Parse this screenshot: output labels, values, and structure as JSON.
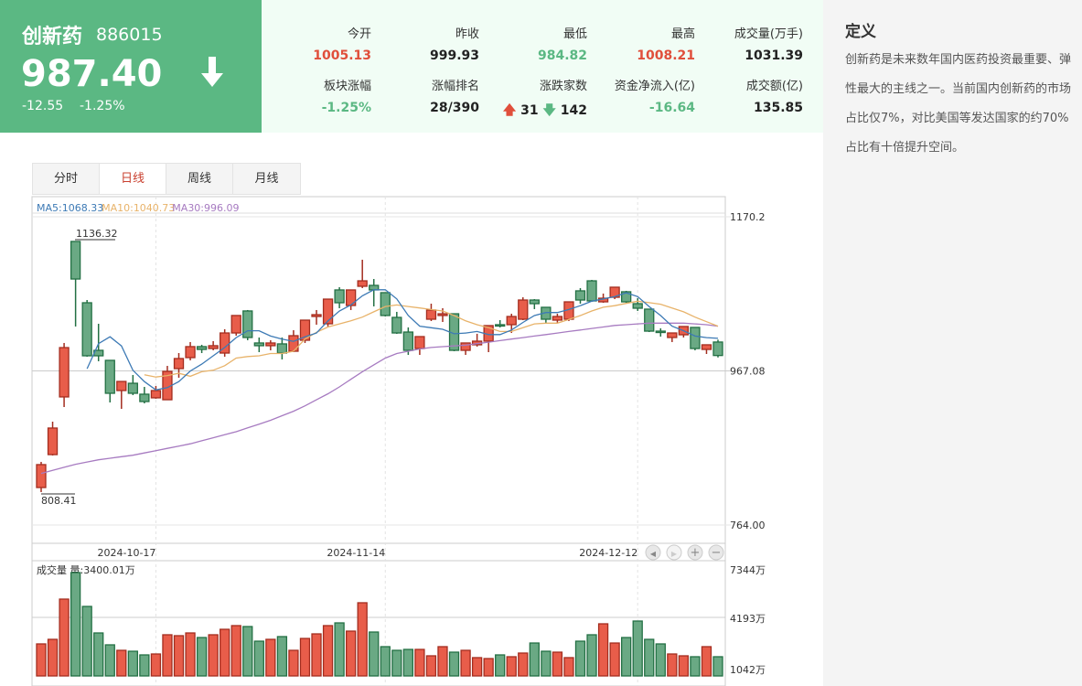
{
  "quote": {
    "name": "创新药",
    "code": "886015",
    "price": "987.40",
    "change": "-12.55",
    "change_pct": "-1.25%",
    "direction_icon": "arrow-down"
  },
  "stats": [
    {
      "label": "今开",
      "value": "1005.13",
      "tone": "red"
    },
    {
      "label": "昨收",
      "value": "999.93",
      "tone": "dark"
    },
    {
      "label": "最低",
      "value": "984.82",
      "tone": "green"
    },
    {
      "label": "最高",
      "value": "1008.21",
      "tone": "red"
    },
    {
      "label": "成交量(万手)",
      "value": "1031.39",
      "tone": "dark"
    },
    {
      "label": "板块涨幅",
      "value": "-1.25%",
      "tone": "green"
    },
    {
      "label": "涨幅排名",
      "value": "28/390",
      "tone": "dark"
    },
    {
      "label": "涨跌家数",
      "up": "31",
      "down": "142"
    },
    {
      "label": "资金净流入(亿)",
      "value": "-16.64",
      "tone": "green"
    },
    {
      "label": "成交额(亿)",
      "value": "135.85",
      "tone": "dark"
    }
  ],
  "definition": {
    "title": "定义",
    "text": "创新药是未来数年国内医药投资最重要、弹性最大的主线之一。当前国内创新药的市场占比仅7%，对比美国等发达国家的约70%占比有十倍提升空间。"
  },
  "tabs": [
    {
      "label": "分时",
      "active": false
    },
    {
      "label": "日线",
      "active": true
    },
    {
      "label": "周线",
      "active": false
    },
    {
      "label": "月线",
      "active": false
    }
  ],
  "colors": {
    "up": "#e85d4a",
    "down": "#6aa984",
    "ma5": "#3d7ab5",
    "ma10": "#e8b36a",
    "ma30": "#a77bc1"
  },
  "chart_data": {
    "type": "candlestick",
    "ma_legend": [
      {
        "label": "MA5:1068.33",
        "key": "ma5"
      },
      {
        "label": "MA10:1040.73",
        "key": "ma10"
      },
      {
        "label": "MA30:996.09",
        "key": "ma30"
      }
    ],
    "y_ticks": [
      "1170.2",
      "967.08",
      "764.00"
    ],
    "ylim": [
      764.0,
      1170.2
    ],
    "x_ticks": [
      {
        "label": "2024-10-17",
        "index": 10
      },
      {
        "label": "2024-11-14",
        "index": 30
      },
      {
        "label": "2024-12-12",
        "index": 52
      }
    ],
    "max_label": "1136.32",
    "min_label": "808.41",
    "candles": [
      [
        813.4,
        843.6,
        847.2,
        807.4
      ],
      [
        856.8,
        891.8,
        900.2,
        855.6
      ],
      [
        932.8,
        997.8,
        1003.9,
        919.5
      ],
      [
        1137.7,
        1088.2,
        1137.7,
        1025.6
      ],
      [
        1056.9,
        987.0,
        1060.5,
        985.8
      ],
      [
        994.2,
        987.0,
        1029.2,
        979.8
      ],
      [
        981.0,
        937.6,
        981.0,
        925.5
      ],
      [
        941.2,
        953.2,
        953.2,
        917.1
      ],
      [
        950.8,
        937.6,
        961.7,
        935.2
      ],
      [
        936.4,
        926.7,
        946.0,
        924.3
      ],
      [
        931.6,
        941.2,
        947.2,
        930.4
      ],
      [
        929.1,
        966.5,
        973.7,
        929.1
      ],
      [
        970.1,
        983.4,
        990.6,
        958.1
      ],
      [
        984.6,
        999.1,
        1005.1,
        981.0
      ],
      [
        999.1,
        995.4,
        1001.5,
        990.6
      ],
      [
        996.6,
        1000.3,
        1006.3,
        994.2
      ],
      [
        990.6,
        1017.1,
        1022.0,
        985.8
      ],
      [
        1017.1,
        1040.1,
        1040.1,
        1013.5
      ],
      [
        1046.1,
        1011.1,
        1047.3,
        1007.5
      ],
      [
        1003.9,
        1000.3,
        1011.1,
        991.8
      ],
      [
        1000.3,
        1003.9,
        1007.5,
        994.2
      ],
      [
        1002.7,
        990.6,
        1011.1,
        982.2
      ],
      [
        993.0,
        1013.5,
        1020.7,
        991.8
      ],
      [
        1007.5,
        1034.0,
        1034.0,
        1003.9
      ],
      [
        1038.8,
        1041.2,
        1047.3,
        1028.0
      ],
      [
        1029.2,
        1061.7,
        1061.7,
        1025.6
      ],
      [
        1073.8,
        1056.9,
        1077.4,
        1049.7
      ],
      [
        1053.3,
        1073.8,
        1073.8,
        1047.3
      ],
      [
        1078.6,
        1085.8,
        1113.6,
        1076.2
      ],
      [
        1079.8,
        1073.8,
        1088.2,
        1052.1
      ],
      [
        1070.2,
        1040.1,
        1070.2,
        1038.8
      ],
      [
        1037.6,
        1017.1,
        1044.9,
        1015.9
      ],
      [
        1018.3,
        994.2,
        1024.4,
        988.2
      ],
      [
        996.6,
        1012.3,
        1012.3,
        988.2
      ],
      [
        1035.2,
        1047.3,
        1055.7,
        1032.8
      ],
      [
        1040.1,
        1042.4,
        1049.7,
        1031.6
      ],
      [
        1042.4,
        994.2,
        1042.4,
        993.0
      ],
      [
        994.2,
        1003.9,
        1003.9,
        988.2
      ],
      [
        1001.5,
        1006.3,
        1016.0,
        999.1
      ],
      [
        1006.3,
        1026.8,
        1026.8,
        991.8
      ],
      [
        1028.0,
        1026.8,
        1034.0,
        1024.4
      ],
      [
        1028.0,
        1038.8,
        1042.4,
        1017.1
      ],
      [
        1035.2,
        1060.5,
        1064.1,
        1034.0
      ],
      [
        1060.5,
        1055.7,
        1061.7,
        1048.5
      ],
      [
        1050.9,
        1035.2,
        1050.9,
        1030.4
      ],
      [
        1034.0,
        1038.8,
        1042.4,
        1030.4
      ],
      [
        1035.2,
        1058.1,
        1058.1,
        1032.8
      ],
      [
        1072.6,
        1060.5,
        1076.2,
        1055.7
      ],
      [
        1085.8,
        1059.3,
        1087.0,
        1058.1
      ],
      [
        1058.1,
        1062.9,
        1069.0,
        1056.9
      ],
      [
        1064.1,
        1077.4,
        1077.4,
        1061.7
      ],
      [
        1071.4,
        1058.1,
        1072.6,
        1056.9
      ],
      [
        1055.7,
        1049.7,
        1062.9,
        1046.1
      ],
      [
        1048.5,
        1019.5,
        1048.5,
        1018.3
      ],
      [
        1019.5,
        1018.3,
        1023.2,
        1012.3
      ],
      [
        1011.1,
        1017.1,
        1017.1,
        1005.1
      ],
      [
        1014.7,
        1025.6,
        1025.6,
        1011.1
      ],
      [
        1024.4,
        996.6,
        1024.4,
        994.2
      ],
      [
        995.4,
        1001.5,
        1001.5,
        989.4
      ],
      [
        1005.13,
        987.4,
        1008.21,
        984.82
      ]
    ],
    "ma5": [
      null,
      null,
      null,
      null,
      970,
      1003,
      1012,
      1000,
      968,
      953,
      942,
      945,
      953,
      967,
      976,
      987,
      998,
      1011,
      1020,
      1020,
      1013,
      1009,
      1006,
      1012,
      1017,
      1033,
      1046,
      1054,
      1066,
      1074,
      1074,
      1062,
      1040,
      1026,
      1024,
      1022,
      1016,
      1017,
      1019,
      1015,
      1015,
      1021,
      1031,
      1040,
      1044,
      1044,
      1048,
      1053,
      1059,
      1062,
      1065,
      1070,
      1065,
      1052,
      1040,
      1026,
      1020,
      1013,
      1011,
      1010
    ],
    "ma10": [
      null,
      null,
      null,
      null,
      null,
      null,
      null,
      null,
      null,
      962,
      959,
      961,
      964,
      960,
      966,
      968,
      974,
      984,
      986,
      987,
      990,
      990,
      993,
      1009,
      1018,
      1025,
      1029,
      1033,
      1038,
      1045,
      1052,
      1054,
      1052,
      1050,
      1048,
      1046,
      1040,
      1033,
      1028,
      1024,
      1019,
      1019,
      1024,
      1029,
      1030,
      1030,
      1035,
      1040,
      1046,
      1051,
      1053,
      1056,
      1059,
      1057,
      1055,
      1050,
      1045,
      1038,
      1032,
      1026
    ],
    "ma30": [
      832,
      836,
      840,
      844,
      847,
      850,
      852,
      854,
      856,
      859,
      862,
      865,
      868,
      871,
      875,
      879,
      883,
      887,
      892,
      897,
      902,
      908,
      914,
      921,
      929,
      937,
      946,
      956,
      966,
      975,
      984,
      990,
      993,
      996,
      998,
      999,
      1000,
      1001,
      1003,
      1005,
      1007,
      1009,
      1011,
      1013,
      1015,
      1017,
      1019,
      1021,
      1023,
      1025,
      1027,
      1028,
      1029,
      1030,
      1030,
      1030,
      1030,
      1029,
      1028,
      1026
    ],
    "volume": {
      "title": "成交量 量:3400.01万",
      "y_ticks": [
        "7344万",
        "4193万",
        "1042万"
      ],
      "ylim": [
        0,
        7344
      ],
      "values": [
        2603,
        2892,
        5435,
        7111,
        4972,
        3296,
        2545,
        2198,
        2140,
        1909,
        1967,
        3181,
        3123,
        3296,
        3007,
        3181,
        3527,
        3759,
        3701,
        2776,
        2892,
        3065,
        2198,
        2949,
        3238,
        3759,
        3932,
        3412,
        5204,
        3354,
        2429,
        2198,
        2256,
        2256,
        1851,
        2429,
        2082,
        2198,
        1736,
        1678,
        1909,
        1793,
        2025,
        2660,
        2140,
        2082,
        1736,
        2776,
        3181,
        3874,
        2660,
        3007,
        4048,
        2892,
        2603,
        1967,
        1851,
        1793,
        2429,
        1793
      ]
    }
  },
  "nav_buttons": [
    {
      "name": "scroll-left",
      "glyph": "◀"
    },
    {
      "name": "scroll-right",
      "glyph": "▶"
    },
    {
      "name": "zoom-in",
      "glyph": "+"
    },
    {
      "name": "zoom-out",
      "glyph": "−"
    }
  ]
}
